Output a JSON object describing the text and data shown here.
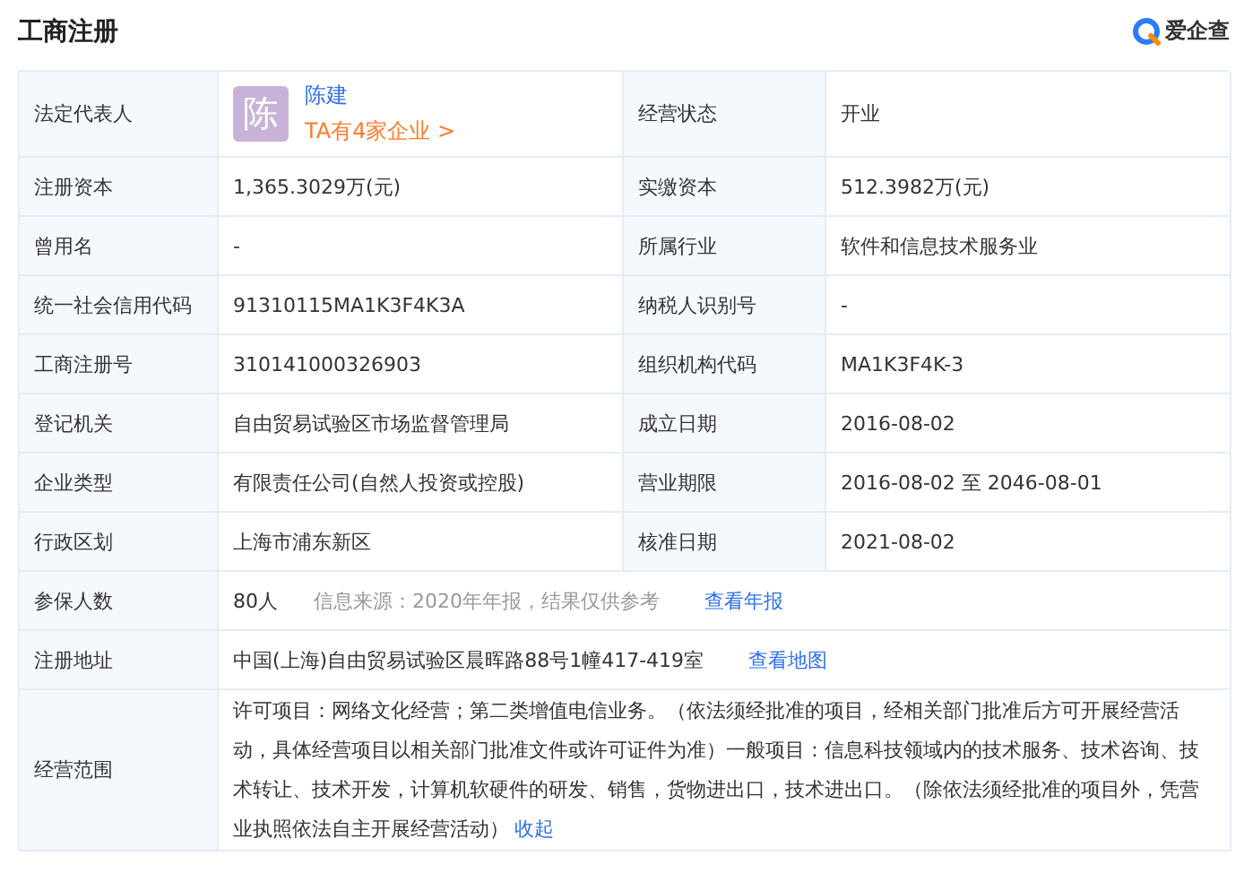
{
  "title": "工商注册",
  "brand": {
    "name": "爱企查"
  },
  "legal_rep": {
    "label": "法定代表人",
    "avatar": "陈",
    "name": "陈建",
    "companies_link": "TA有4家企业 >"
  },
  "status": {
    "label": "经营状态",
    "value": "开业"
  },
  "pairs": [
    {
      "label": "注册资本",
      "value": "1,365.3029万(元)",
      "label2": "实缴资本",
      "value2": "512.3982万(元)"
    },
    {
      "label": "曾用名",
      "value": "-",
      "label2": "所属行业",
      "value2": "软件和信息技术服务业"
    },
    {
      "label": "统一社会信用代码",
      "value": "91310115MA1K3F4K3A",
      "label2": "纳税人识别号",
      "value2": "-"
    },
    {
      "label": "工商注册号",
      "value": "310141000326903",
      "label2": "组织机构代码",
      "value2": "MA1K3F4K-3"
    },
    {
      "label": "登记机关",
      "value": "自由贸易试验区市场监督管理局",
      "label2": "成立日期",
      "value2": "2016-08-02"
    },
    {
      "label": "企业类型",
      "value": "有限责任公司(自然人投资或控股)",
      "label2": "营业期限",
      "value2": "2016-08-02 至 2046-08-01"
    },
    {
      "label": "行政区划",
      "value": "上海市浦东新区",
      "label2": "核准日期",
      "value2": "2021-08-02"
    }
  ],
  "wide_rows": [
    {
      "kind": "insured",
      "label": "参保人数",
      "value": "80人",
      "note": "信息来源：2020年年报，结果仅供参考",
      "link": "查看年报"
    },
    {
      "kind": "address",
      "label": "注册地址",
      "value": "中国(上海)自由贸易试验区晨晖路88号1幢417-419室",
      "link": "查看地图"
    },
    {
      "kind": "scope",
      "label": "经营范围",
      "value": "许可项目：网络文化经营；第二类增值电信业务。（依法须经批准的项目，经相关部门批准后方可开展经营活动，具体经营项目以相关部门批准文件或许可证件为准）一般项目：信息科技领域内的技术服务、技术咨询、技术转让、技术开发，计算机软硬件的研发、销售，货物进出口，技术进出口。（除依法须经批准的项目外，凭营业执照依法自主开展经营活动）",
      "link": "收起"
    }
  ]
}
